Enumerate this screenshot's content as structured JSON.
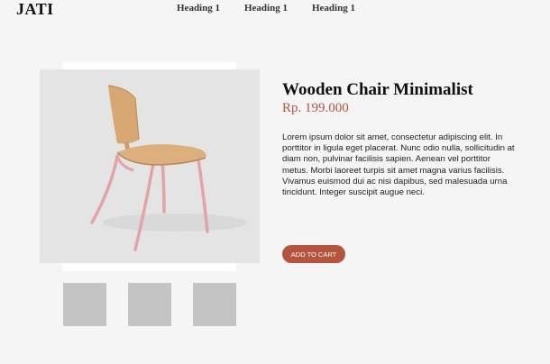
{
  "header": {
    "logo": "JATI",
    "nav": [
      "Heading 1",
      "Heading 1",
      "Heading 1"
    ]
  },
  "product": {
    "title": "Wooden Chair Minimalist",
    "price": "Rp. 199.000",
    "description": "Lorem ipsum dolor sit amet, consectetur adipiscing elit. In porttitor in ligula eget placerat. Nunc odio nulla, sollicitudin at diam non, pulvinar facilisis sapien. Aenean vel porttitor metus. Morbi laoreet turpis sit amet magna varius facilisis. Vivamus euismod dui ac nisi dapibus, sed malesuada urna tincidunt. Integer suscipit augue neci.",
    "add_to_cart_label": "ADD TO CART",
    "image_icon": "wooden-chair",
    "thumbnail_count": 3
  },
  "colors": {
    "accent": "#b4533e",
    "background": "#f5f5f5",
    "thumbnail": "#c4c4c4",
    "image_bg": "#e4e4e4",
    "chair_wood": "#d7a873",
    "chair_legs": "#e2a4a8"
  }
}
